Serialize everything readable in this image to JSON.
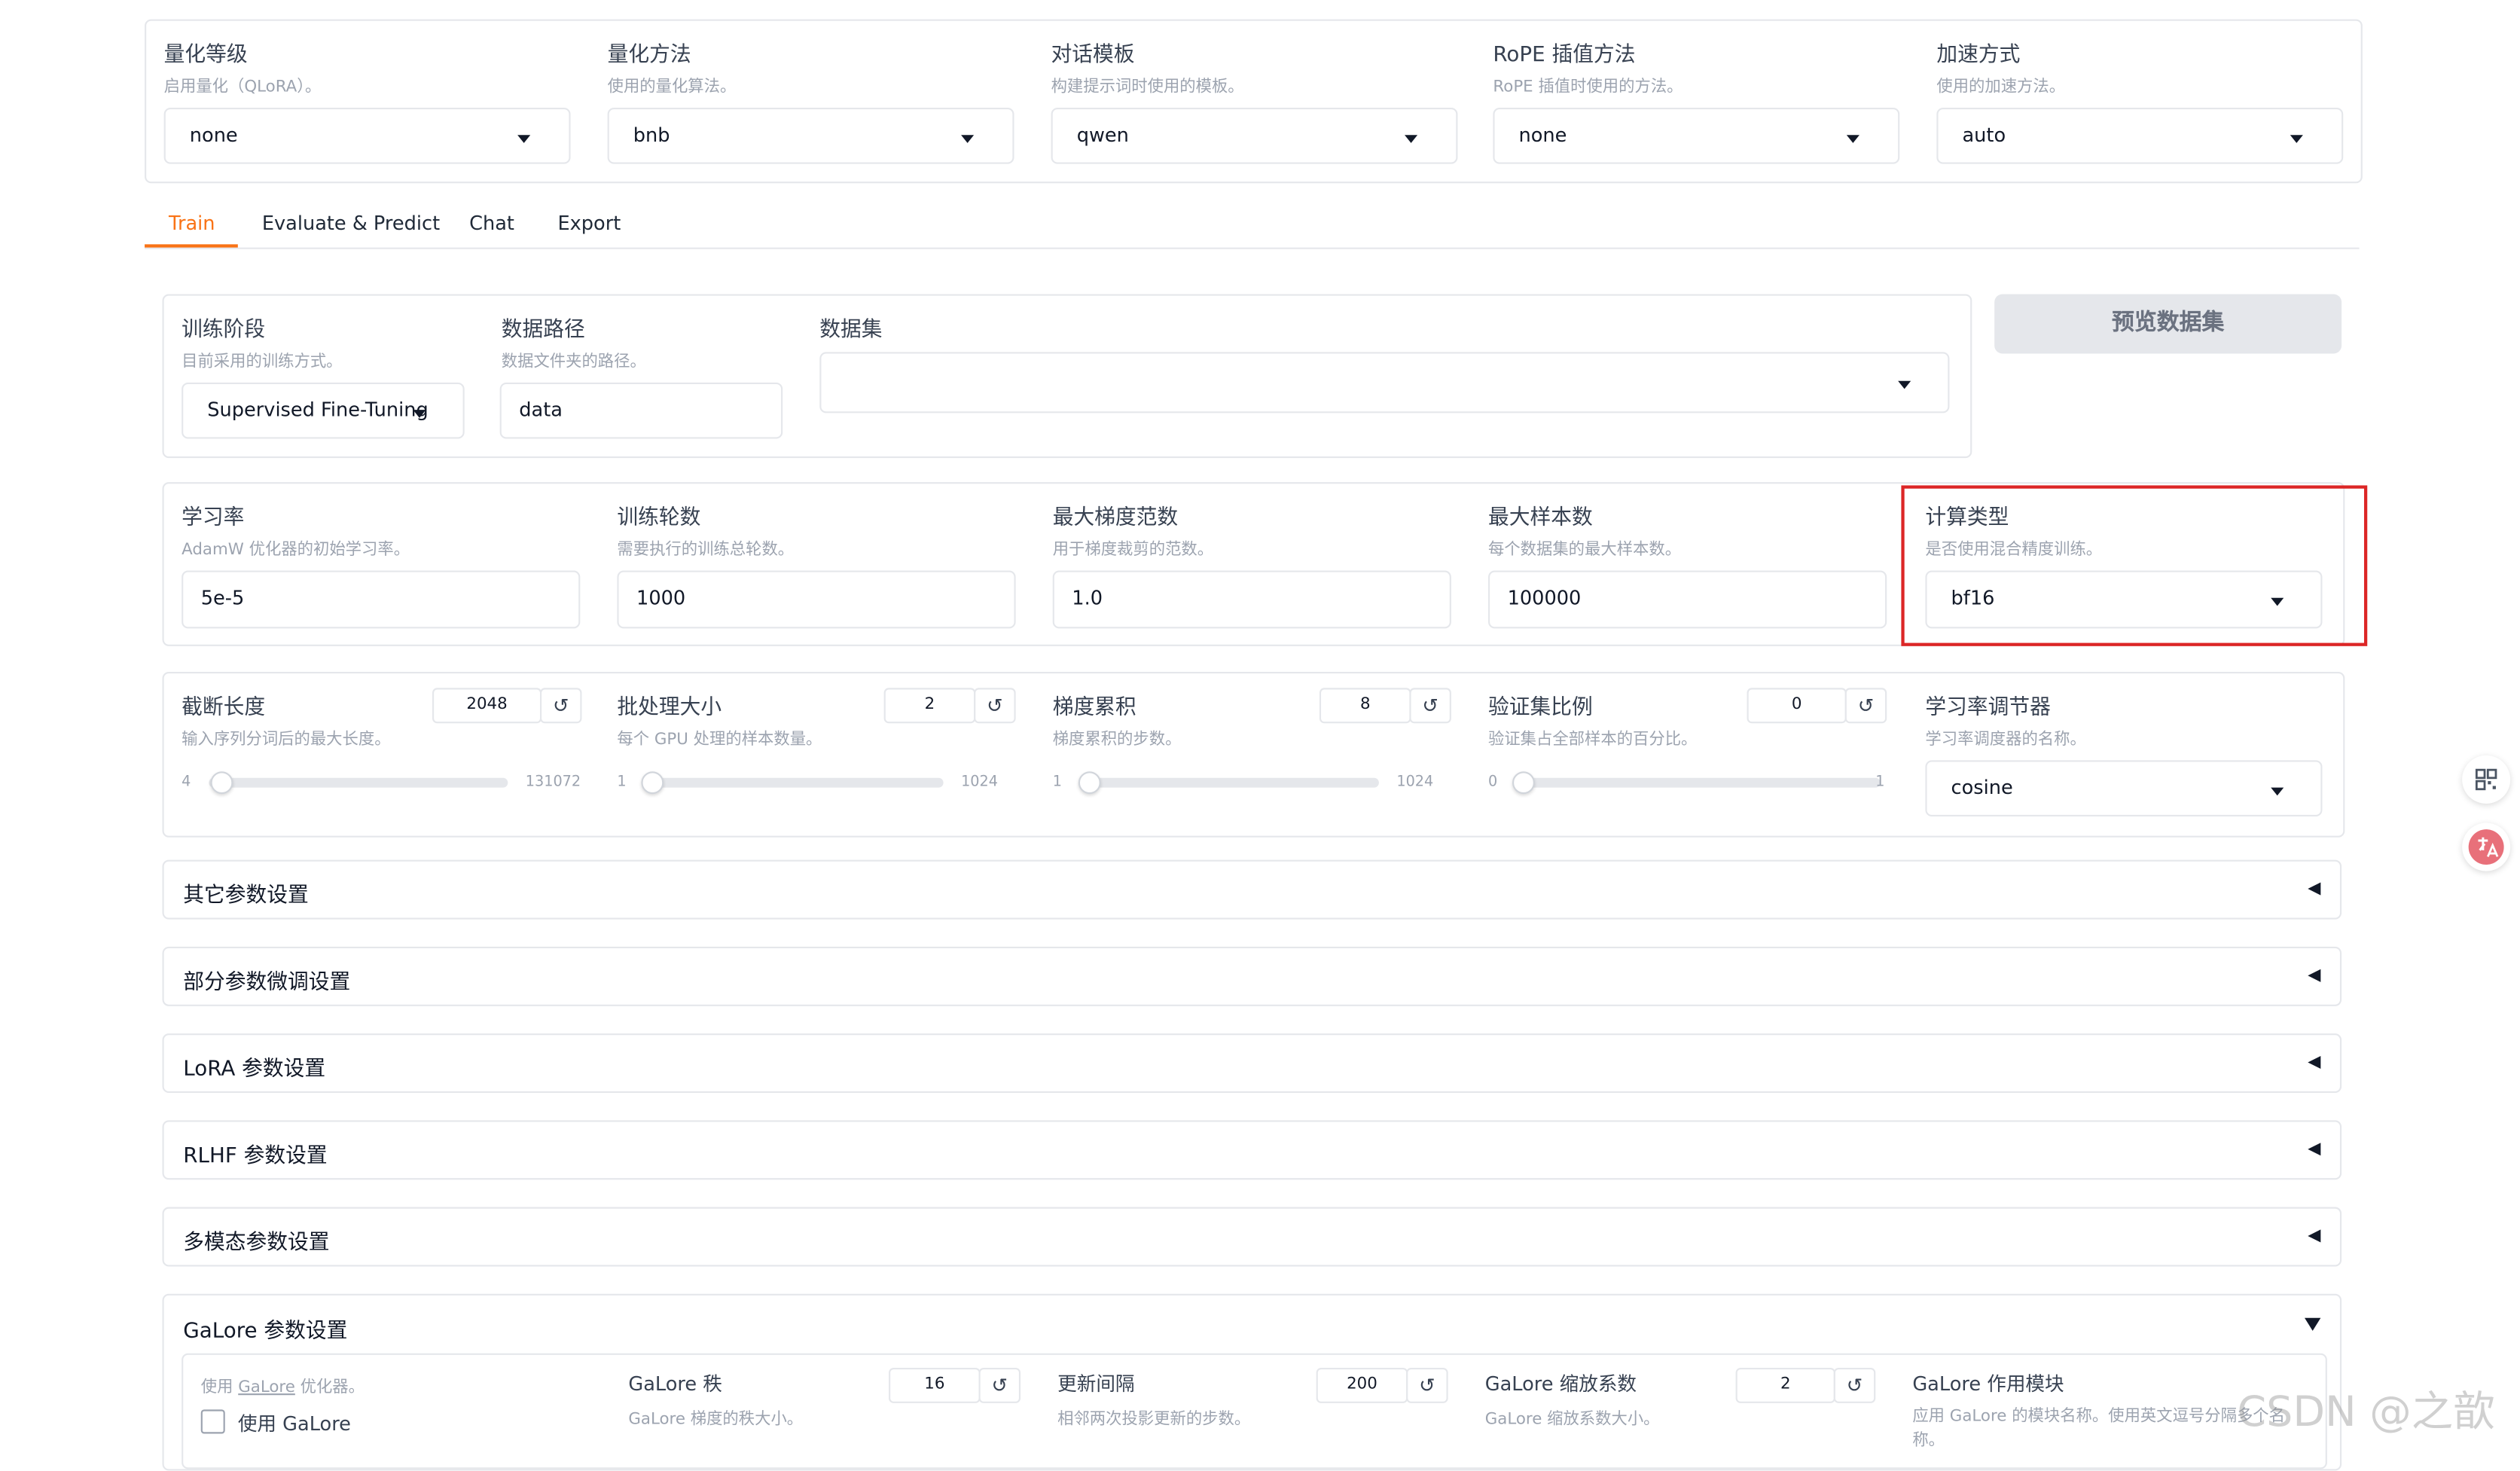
{
  "top": {
    "fields": [
      {
        "label": "量化等级",
        "hint": "启用量化（QLoRA）。",
        "value": "none"
      },
      {
        "label": "量化方法",
        "hint": "使用的量化算法。",
        "value": "bnb"
      },
      {
        "label": "对话模板",
        "hint": "构建提示词时使用的模板。",
        "value": "qwen"
      },
      {
        "label": "RoPE 插值方法",
        "hint": "RoPE 插值时使用的方法。",
        "value": "none"
      },
      {
        "label": "加速方式",
        "hint": "使用的加速方法。",
        "value": "auto"
      }
    ]
  },
  "tabs": [
    "Train",
    "Evaluate & Predict",
    "Chat",
    "Export"
  ],
  "active_tab": "Train",
  "train": {
    "stage": {
      "label": "训练阶段",
      "hint": "目前采用的训练方式。",
      "value": "Supervised Fine-Tuning"
    },
    "data_dir": {
      "label": "数据路径",
      "hint": "数据文件夹的路径。",
      "value": "data"
    },
    "dataset": {
      "label": "数据集",
      "value": ""
    },
    "preview_button": "预览数据集",
    "learning_rate": {
      "label": "学习率",
      "hint": "AdamW 优化器的初始学习率。",
      "value": "5e-5"
    },
    "epochs": {
      "label": "训练轮数",
      "hint": "需要执行的训练总轮数。",
      "value": "1000"
    },
    "max_grad_norm": {
      "label": "最大梯度范数",
      "hint": "用于梯度裁剪的范数。",
      "value": "1.0"
    },
    "max_samples": {
      "label": "最大样本数",
      "hint": "每个数据集的最大样本数。",
      "value": "100000"
    },
    "compute_type": {
      "label": "计算类型",
      "hint": "是否使用混合精度训练。",
      "value": "bf16"
    },
    "sliders": [
      {
        "label": "截断长度",
        "hint": "输入序列分词后的最大长度。",
        "value": "2048",
        "min": "4",
        "max": "131072",
        "fraction": 0.016
      },
      {
        "label": "批处理大小",
        "hint": "每个 GPU 处理的样本数量。",
        "value": "2",
        "min": "1",
        "max": "1024",
        "fraction": 0.001
      },
      {
        "label": "梯度累积",
        "hint": "梯度累积的步数。",
        "value": "8",
        "min": "1",
        "max": "1024",
        "fraction": 0.007
      },
      {
        "label": "验证集比例",
        "hint": "验证集占全部样本的百分比。",
        "value": "0",
        "min": "0",
        "max": "1",
        "fraction": 0
      }
    ],
    "lr_scheduler": {
      "label": "学习率调节器",
      "hint": "学习率调度器的名称。",
      "value": "cosine"
    }
  },
  "accordions": [
    "其它参数设置",
    "部分参数微调设置",
    "LoRA 参数设置",
    "RLHF 参数设置",
    "多模态参数设置"
  ],
  "galore": {
    "title": "GaLore 参数设置",
    "use_hint_prefix": "使用 ",
    "use_hint_link": "GaLore",
    "use_hint_suffix": " 优化器。",
    "use_label": "使用 GaLore",
    "rank": {
      "label": "GaLore 秩",
      "hint": "GaLore 梯度的秩大小。",
      "value": "16"
    },
    "update_interval": {
      "label": "更新间隔",
      "hint": "相邻两次投影更新的步数。",
      "value": "200"
    },
    "scale": {
      "label": "GaLore 缩放系数",
      "hint": "GaLore 缩放系数大小。",
      "value": "2"
    },
    "target": {
      "label": "GaLore 作用模块",
      "hint": "应用 GaLore 的模块名称。使用英文逗号分隔多个名称。"
    }
  },
  "watermark": "CSDN @之歆",
  "colors": {
    "accent": "#f97316",
    "highlight": "#dc2626",
    "button_bg": "#e5e7eb"
  },
  "side_icons": [
    "qr-code-icon",
    "translate-icon"
  ]
}
